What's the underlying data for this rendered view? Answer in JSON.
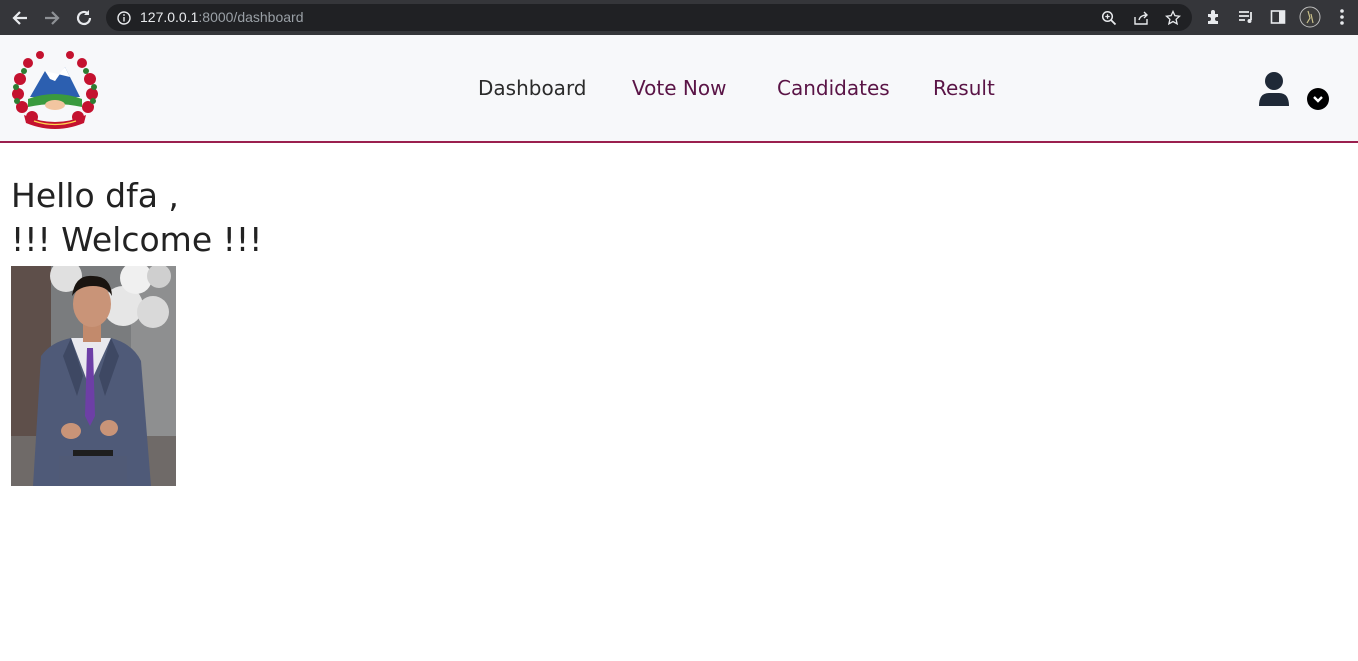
{
  "browser": {
    "url_host": "127.0.0.1",
    "url_rest": ":8000/dashboard",
    "icons": [
      "back-icon",
      "forward-icon",
      "reload-icon",
      "info-icon",
      "zoom-icon",
      "share-icon",
      "star-icon",
      "extensions-icon",
      "media-icon",
      "sidepanel-icon",
      "profile-avatar",
      "menu-icon"
    ]
  },
  "navbar": {
    "logo_alt": "Emblem of Nepal",
    "menu": [
      {
        "label": "Dashboard",
        "color": "#2b2b2b"
      },
      {
        "label": "Vote Now",
        "color": "#5a1446"
      },
      {
        "label": "Candidates",
        "color": "#5a1446"
      },
      {
        "label": "Result",
        "color": "#5a1446"
      }
    ],
    "border_color": "#9a1f4e"
  },
  "main": {
    "greeting_line1": "Hello dfa ,",
    "greeting_line2": "!!! Welcome !!!",
    "photo_alt": "User profile photo"
  }
}
